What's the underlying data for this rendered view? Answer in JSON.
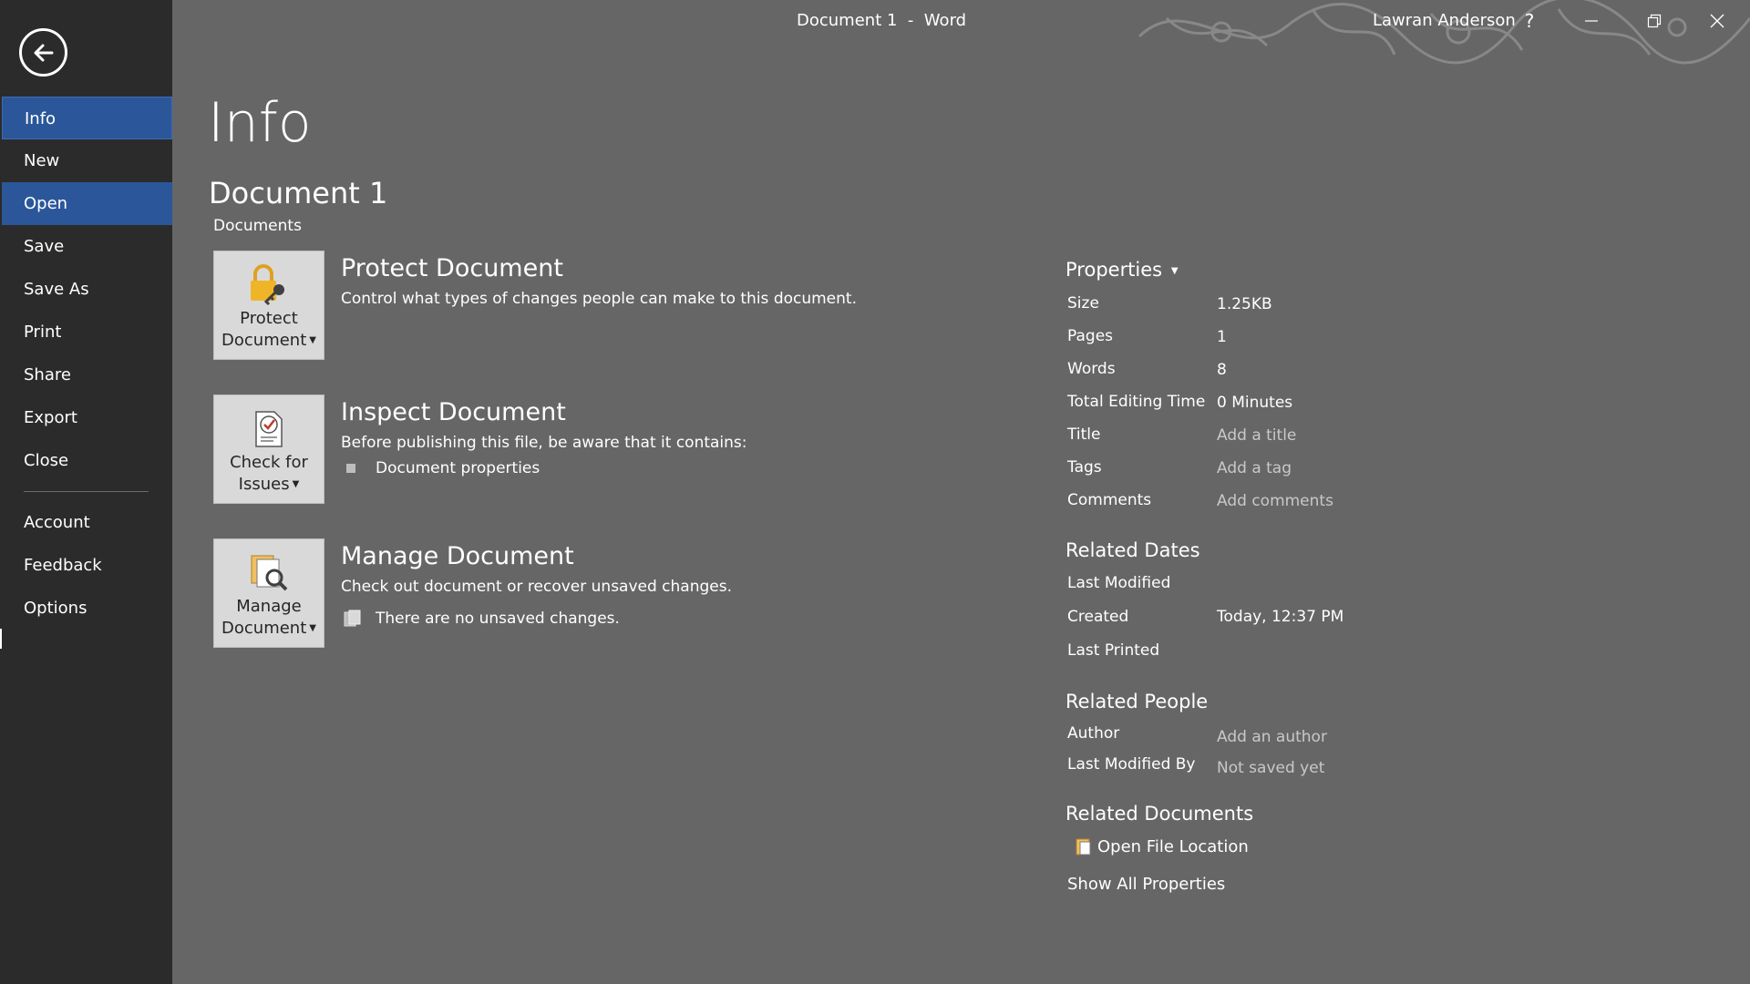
{
  "window": {
    "title": "Document 1  -  Word",
    "user": "Lawran Anderson",
    "help_label": "?"
  },
  "sidebar": {
    "items": [
      {
        "label": "Info"
      },
      {
        "label": "New"
      },
      {
        "label": "Open"
      },
      {
        "label": "Save"
      },
      {
        "label": "Save As"
      },
      {
        "label": "Print"
      },
      {
        "label": "Share"
      },
      {
        "label": "Export"
      },
      {
        "label": "Close"
      }
    ],
    "bottom_items": [
      {
        "label": "Account"
      },
      {
        "label": "Feedback"
      },
      {
        "label": "Options"
      }
    ],
    "selected": "Info",
    "hovered": "Open"
  },
  "main": {
    "page_title": "Info",
    "document_name": "Document 1",
    "location": "Documents",
    "protect": {
      "button_line1": "Protect",
      "button_line2": "Document",
      "title": "Protect Document",
      "description": "Control what types of changes people can make to this document."
    },
    "inspect": {
      "button_line1": "Check for",
      "button_line2": "Issues",
      "title": "Inspect Document",
      "description": "Before publishing this file, be aware that it contains:",
      "bullet": "Document properties"
    },
    "manage": {
      "button_line1": "Manage",
      "button_line2": "Document",
      "title": "Manage Document",
      "description": "Check out document or recover unsaved changes.",
      "bullet": "There are no unsaved changes."
    }
  },
  "properties": {
    "header": "Properties",
    "size_label": "Size",
    "size": "1.25KB",
    "pages_label": "Pages",
    "pages": "1",
    "words_label": "Words",
    "words": "8",
    "editing_time_label": "Total Editing Time",
    "editing_time": "0 Minutes",
    "title_label": "Title",
    "title_placeholder": "Add a title",
    "tags_label": "Tags",
    "tags_placeholder": "Add a tag",
    "comments_label": "Comments",
    "comments_placeholder": "Add comments",
    "related_dates": {
      "header": "Related Dates",
      "last_modified_label": "Last Modified",
      "created_label": "Created",
      "created": "Today, 12:37 PM",
      "last_printed_label": "Last Printed"
    },
    "related_people": {
      "header": "Related People",
      "author_label": "Author",
      "author_placeholder": "Add an author",
      "last_modified_by_label": "Last Modified By",
      "last_modified_by": "Not saved yet"
    },
    "related_documents": {
      "header": "Related Documents",
      "open_file_location": "Open File Location"
    },
    "show_all": "Show All Properties"
  },
  "colors": {
    "sidebar_bg": "#2b2b2b",
    "main_bg": "#666666",
    "accent": "#2b579a",
    "tile_bg": "#d9d9d9"
  }
}
